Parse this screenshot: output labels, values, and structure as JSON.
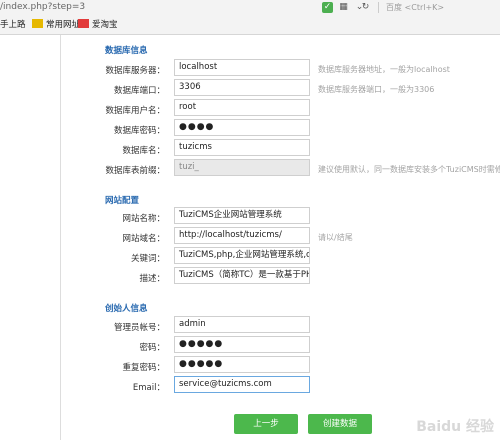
{
  "browser": {
    "url": "/index.php?step=3",
    "search_placeholder": "百度 <Ctrl+K>",
    "bookmarks": [
      {
        "label": "手上路"
      },
      {
        "label": "常用网址"
      },
      {
        "label": "爱淘宝"
      }
    ]
  },
  "sections": {
    "db": "数据库信息",
    "site": "网站配置",
    "admin": "创始人信息"
  },
  "db_fields": [
    {
      "label": "数据库服务器：",
      "value": "localhost",
      "hint": "数据库服务器地址，一般为localhost"
    },
    {
      "label": "数据库端口：",
      "value": "3306",
      "hint": "数据库服务器端口，一般为3306"
    },
    {
      "label": "数据库用户名：",
      "value": "root",
      "hint": ""
    },
    {
      "label": "数据库密码：",
      "value": "●●●●",
      "hint": ""
    },
    {
      "label": "数据库名：",
      "value": "tuzicms",
      "hint": ""
    },
    {
      "label": "数据库表前缀：",
      "value": "tuzi_",
      "hint": "建议使用默认，同一数据库安装多个TuziCMS时需修改"
    }
  ],
  "site_fields": [
    {
      "label": "网站名称：",
      "value": "TuziCMS企业网站管理系统",
      "hint": ""
    },
    {
      "label": "网站域名：",
      "value": "http://localhost/tuzicms/",
      "hint": "请以/结尾"
    },
    {
      "label": "关键词：",
      "value": "TuziCMS,php,企业网站管理系统,cr",
      "hint": ""
    },
    {
      "label": "描述：",
      "value": "TuziCMS（简称TC）是一款基于PH",
      "hint": ""
    }
  ],
  "admin_fields": [
    {
      "label": "管理员帐号：",
      "value": "admin"
    },
    {
      "label": "密码：",
      "value": "●●●●●"
    },
    {
      "label": "重复密码：",
      "value": "●●●●●"
    },
    {
      "label": "Email：",
      "value": "service@tuzicms.com"
    }
  ],
  "buttons": {
    "prev": "上一步",
    "create": "创建数据"
  },
  "watermark": "Baidu 经验",
  "colors": {
    "section": "#2a6ab0",
    "button": "#4cb84c"
  }
}
